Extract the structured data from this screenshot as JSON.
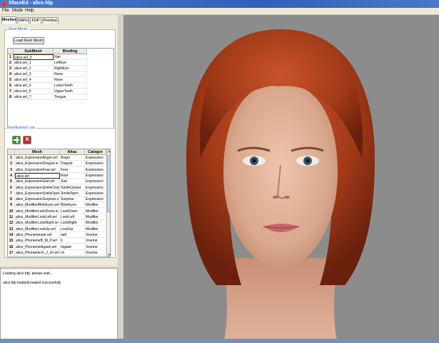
{
  "window": {
    "title": "XfaceEd - alice.fdp"
  },
  "menu": [
    {
      "label": "File"
    },
    {
      "label": "Mode"
    },
    {
      "label": "Help"
    }
  ],
  "tabs": [
    {
      "label": "Meshes"
    },
    {
      "label": "FAPU"
    },
    {
      "label": "FDP"
    },
    {
      "label": "Preview"
    }
  ],
  "rest_mesh": {
    "legend": "Rest Mesh:",
    "load_button": "Load Rest Mesh",
    "columns": [
      "SubMesh",
      "Binding"
    ],
    "rows": [
      {
        "num": "1",
        "submesh": "alice.wrl_0",
        "binding": "Hair"
      },
      {
        "num": "2",
        "submesh": "alice.wrl_1",
        "binding": "LeftEye"
      },
      {
        "num": "3",
        "submesh": "alice.wrl_2",
        "binding": "RightEye"
      },
      {
        "num": "4",
        "submesh": "alice.wrl_3",
        "binding": "None"
      },
      {
        "num": "5",
        "submesh": "alice.wrl_4",
        "binding": "None"
      },
      {
        "num": "6",
        "submesh": "alice.wrl_5",
        "binding": "LowerTeeth"
      },
      {
        "num": "7",
        "submesh": "alice.wrl_6",
        "binding": "UpperTeeth"
      },
      {
        "num": "8",
        "submesh": "alice.wrl_7",
        "binding": "Tongue"
      }
    ]
  },
  "keyframes": {
    "legend": "Keyframes List:",
    "columns": [
      "Mesh",
      "Alias",
      "Categor"
    ],
    "rows": [
      {
        "num": "1",
        "mesh": "alice_ExpressionAnger.wrl",
        "alias": "Anger",
        "category": "Expression"
      },
      {
        "num": "2",
        "mesh": "alice_ExpressionDisgust.w",
        "alias": "Disgust",
        "category": "Expression"
      },
      {
        "num": "3",
        "mesh": "alice_ExpressionFear.wrl",
        "alias": "Fear",
        "category": "Expression"
      },
      {
        "num": "4",
        "mesh": "alice.wrl",
        "alias": "Rest",
        "category": "Expression"
      },
      {
        "num": "5",
        "mesh": "alice_ExpressionSad.wrl",
        "alias": "Sad",
        "category": "Expression"
      },
      {
        "num": "6",
        "mesh": "alice_ExpressionSmileClosed",
        "alias": "SmileClosed",
        "category": "Expression"
      },
      {
        "num": "7",
        "mesh": "alice_ExpressionSmileOpen",
        "alias": "SmileOpen",
        "category": "Expression"
      },
      {
        "num": "8",
        "mesh": "alice_ExpressionSurprise.v",
        "alias": "Surprise",
        "category": "Expression"
      },
      {
        "num": "9",
        "mesh": "alice_ModifierBlinkEyes.wrl",
        "alias": "BlinkEyes",
        "category": "Modifier"
      },
      {
        "num": "10",
        "mesh": "alice_ModifierLookDown.w",
        "alias": "LookDown",
        "category": "Modifier"
      },
      {
        "num": "11",
        "mesh": "alice_ModifierLookLeft.wrl",
        "alias": "LookLeft",
        "category": "Modifier"
      },
      {
        "num": "12",
        "mesh": "alice_ModifierLookRight.wr",
        "alias": "LookRight",
        "category": "Modifier"
      },
      {
        "num": "13",
        "mesh": "alice_ModifierLookUp.wrl",
        "alias": "LookUp",
        "category": "Modifier"
      },
      {
        "num": "14",
        "mesh": "alice_Phonemeaah.wrl",
        "alias": "aah",
        "category": "Viseme"
      },
      {
        "num": "15",
        "mesh": "alice_PhonemeB_M_P.wrl",
        "alias": "b",
        "category": "Viseme"
      },
      {
        "num": "16",
        "mesh": "alice_Phonemebigaah.wrl",
        "alias": "bigaah",
        "category": "Viseme"
      },
      {
        "num": "17",
        "mesh": "alice_Phonemech_J_sh.wrl",
        "alias": "ch",
        "category": "Viseme"
      }
    ]
  },
  "log": [
    {
      "text": "Loading alice.fdp, please wait..."
    },
    {
      "text": "alice.fdp loaded/created successfully"
    }
  ],
  "colors": {
    "hair": "#b0441e",
    "skin": "#e0b59c",
    "viewport_bg": "#8c8c8c"
  },
  "icons": {
    "add": "add-icon",
    "delete": "delete-icon"
  }
}
